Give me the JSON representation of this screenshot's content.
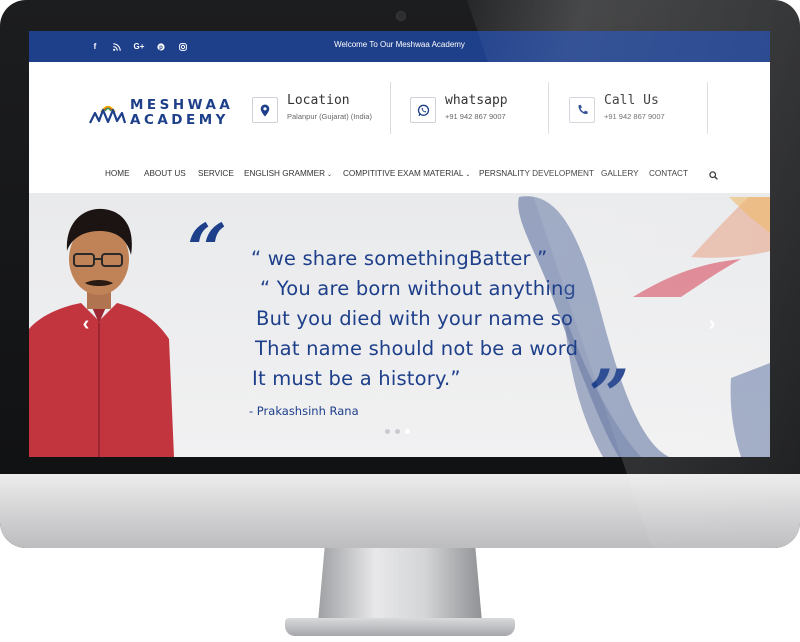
{
  "topbar": {
    "welcome": "Welcome To Our Meshwaa Academy",
    "socials": [
      {
        "icon": "facebook-icon",
        "glyph": "f"
      },
      {
        "icon": "rss-icon",
        "glyph": "◥"
      },
      {
        "icon": "google-plus-icon",
        "glyph": "G+"
      },
      {
        "icon": "pinterest-icon",
        "glyph": "℗"
      },
      {
        "icon": "instagram-icon",
        "glyph": "▣"
      }
    ]
  },
  "logo": {
    "line1": "MESHWAA",
    "line2": "ACADEMY"
  },
  "contacts": {
    "location": {
      "title": "Location",
      "sub": "Palanpur (Gujarat) (India)",
      "icon": "map-pin-icon"
    },
    "whatsapp": {
      "title": "whatsapp",
      "sub": "+91 942 867 9007",
      "icon": "whatsapp-icon"
    },
    "call": {
      "title": "Call Us",
      "sub": "+91 942 867 9007",
      "icon": "phone-icon"
    }
  },
  "nav": {
    "home": "HOME",
    "about": "ABOUT US",
    "service": "SERVICE",
    "english": "ENGLISH GRAMMER",
    "exam": "COMPITITIVE EXAM MATERIAL",
    "personality": "PERSNALITY DEVELOPMENT",
    "gallery": "GALLERY",
    "contact": "CONTACT",
    "search_icon": "search-icon"
  },
  "hero": {
    "open_quote": "“",
    "close_quote": "”",
    "line1": "“ we share somethingBatter ”",
    "line2": "“ You are born without anything",
    "line3": "But you died with your name so",
    "line4": "That name should not be a word",
    "line5": "It must be a history.”",
    "author": "- Prakashsinh Rana",
    "prev": "‹",
    "next": "›",
    "slides": 3,
    "active_slide": 3
  },
  "colors": {
    "brand": "#1e3f8a",
    "topbar": "#1e3f8a",
    "accent_red": "#d23c4f",
    "accent_yellow": "#f2b200"
  }
}
